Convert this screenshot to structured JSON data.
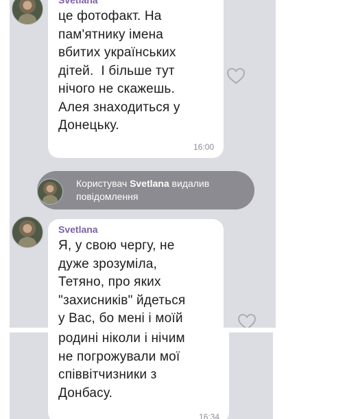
{
  "messages": [
    {
      "sender": "Svetlana",
      "text": "це фотофакт. На\nпам'ятнику імена\nвбитих українських\nдітей.  І більше тут\nнічого не скажешь.\nАлея знаходиться у\nДонецьку.",
      "time": "16:00"
    },
    {
      "sender": "Svetlana",
      "text": "Я, у свою чергу, не\nдуже зрозуміла,\nТетяно, про яких\n\"захисників\" йдеться\nу Вас, бо мені і моїй"
    },
    {
      "text": "родині ніколи і нічим\nне погрожували мої\nспіввітчизники з\nДонбасу.",
      "time": "16:34"
    }
  ],
  "system_notice": {
    "prefix": "Користувач ",
    "user": "Svetlana",
    "suffix": " видалив\nповідомлення"
  },
  "icons": {
    "like": "heart-outline-icon",
    "avatar": "user-avatar"
  },
  "colors": {
    "chat_background": "#dcdde3",
    "bubble": "#ffffff",
    "sender_name": "#7d60a8",
    "system_pill": "#8b8b91"
  }
}
